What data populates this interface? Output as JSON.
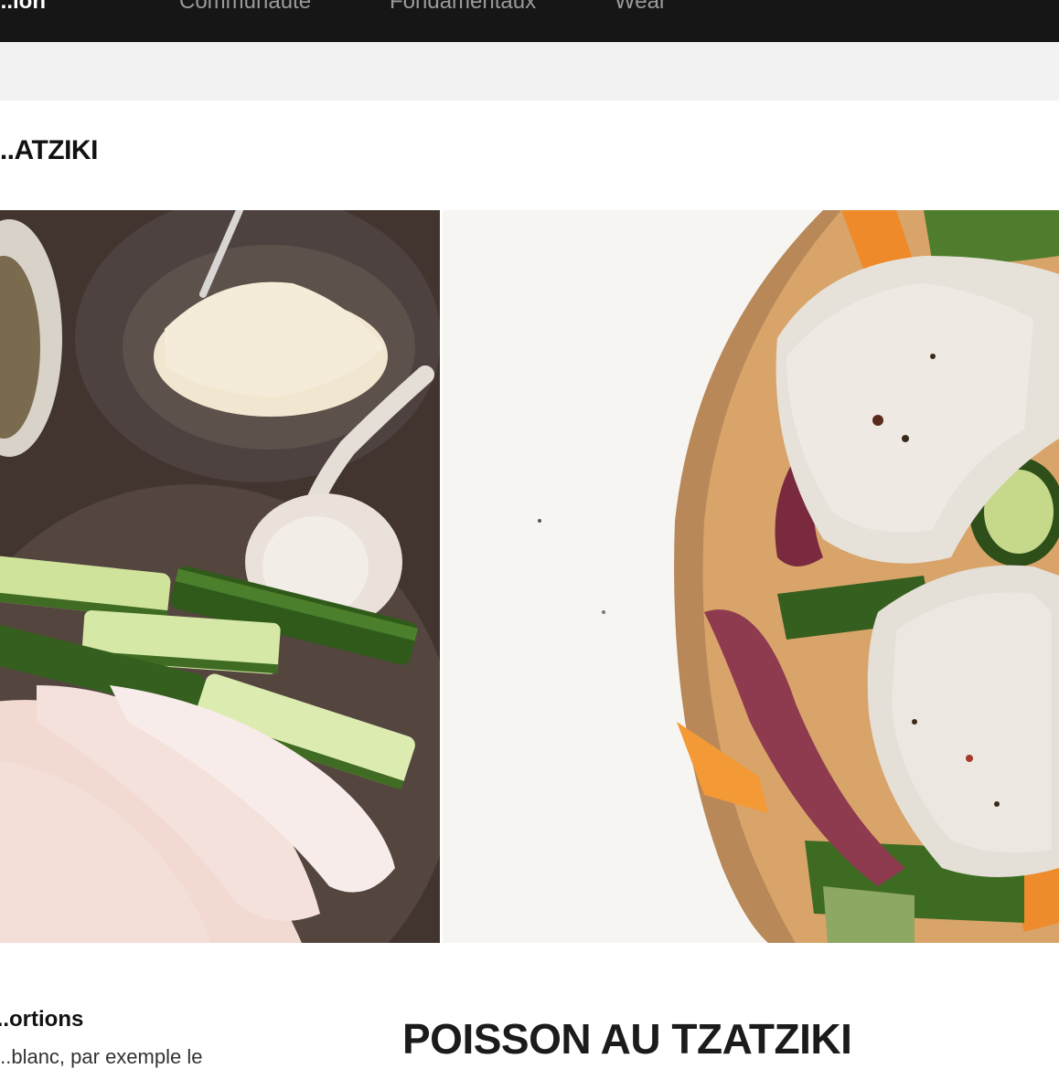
{
  "nav": {
    "brand": "...ion",
    "items": [
      "Communauté",
      "Fondamentaux",
      "Wear"
    ]
  },
  "page": {
    "title": "...ATZIKI",
    "recipe_title": "POISSON AU TZATZIKI"
  },
  "hero": {
    "left_photo_alt": "Ingredients: fish fillets, cucumber, garlic, yogurt, spices",
    "right_photo_alt": "Baked fish with vegetables in a white dish"
  },
  "info": {
    "portions_label": "...ortions",
    "portions_text": "...blanc, par exemple le"
  },
  "colors": {
    "nav_bg": "#161616",
    "subbar_bg": "#f2f2f2",
    "text": "#111111"
  }
}
